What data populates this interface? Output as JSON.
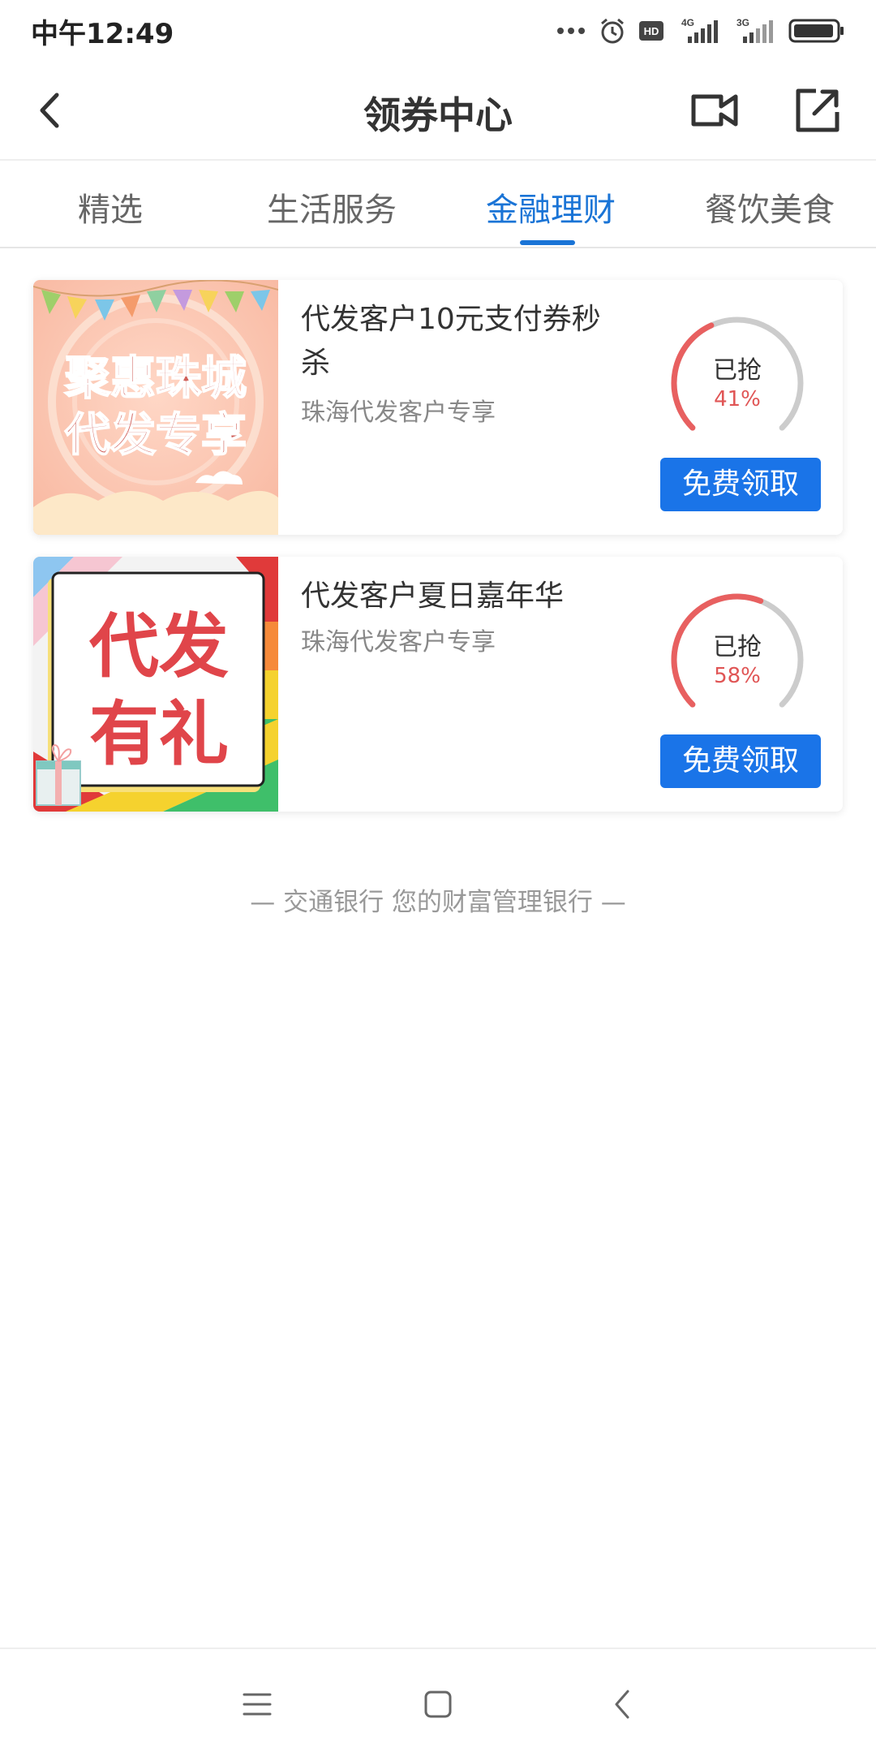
{
  "status_bar": {
    "time": "中午12:49",
    "icons": [
      "more-dots-icon",
      "alarm-icon",
      "hd-icon",
      "signal-4g-icon",
      "signal-3g-icon",
      "battery-icon"
    ],
    "hd_label": "HD",
    "net1": "4G",
    "net2": "3G"
  },
  "header": {
    "title": "领券中心",
    "back_icon": "back-chevron-icon",
    "video_icon": "video-icon",
    "share_icon": "share-icon"
  },
  "tabs": [
    {
      "label": "精选",
      "active": false
    },
    {
      "label": "生活服务",
      "active": false
    },
    {
      "label": "金融理财",
      "active": true
    },
    {
      "label": "餐饮美食",
      "active": false
    }
  ],
  "coupons": [
    {
      "image_text_line1": "聚惠珠城",
      "image_text_line2": "代发专享",
      "title": "代发客户10元支付券秒杀",
      "subtitle": "珠海代发客户专享",
      "progress_label": "已抢",
      "progress_percent": 41,
      "progress_text": "41%",
      "button_label": "免费领取"
    },
    {
      "image_text_line1": "代发",
      "image_text_line2": "有礼",
      "title": "代发客户夏日嘉年华",
      "subtitle": "珠海代发客户专享",
      "progress_label": "已抢",
      "progress_percent": 58,
      "progress_text": "58%",
      "button_label": "免费领取"
    }
  ],
  "footer": {
    "slogan": "— 交通银行 您的财富管理银行 —"
  },
  "nav_bar": {
    "menu_icon": "menu-icon",
    "home_icon": "home-square-icon",
    "back_icon": "back-triangle-icon"
  },
  "colors": {
    "accent": "#1a74d6",
    "button": "#1a74e8",
    "gauge_active": "#e86060",
    "gauge_track": "#cccccc"
  }
}
